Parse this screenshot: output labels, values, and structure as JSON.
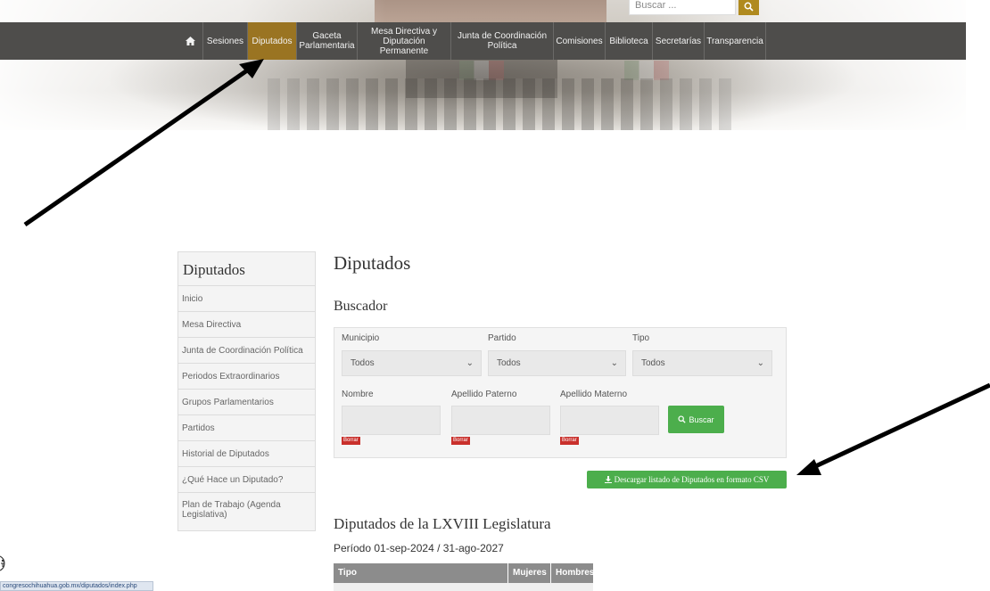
{
  "header": {
    "search_placeholder": "Buscar ...",
    "search_icon": "search-icon",
    "accent_color": "#9a7422"
  },
  "nav": {
    "home_icon": "home-icon",
    "items": [
      {
        "label": "Sesiones"
      },
      {
        "label": "Diputados",
        "active": true
      },
      {
        "label": "Gaceta Parlamentaria"
      },
      {
        "label": "Mesa Directiva y Diputación Permanente"
      },
      {
        "label": "Junta de Coordinación Política"
      },
      {
        "label": "Comisiones"
      },
      {
        "label": "Biblioteca"
      },
      {
        "label": "Secretarías"
      },
      {
        "label": "Transparencia"
      }
    ]
  },
  "sidebar": {
    "title": "Diputados",
    "items": [
      {
        "label": "Inicio"
      },
      {
        "label": "Mesa Directiva"
      },
      {
        "label": "Junta de Coordinación Política"
      },
      {
        "label": "Periodos Extraordinarios"
      },
      {
        "label": "Grupos Parlamentarios"
      },
      {
        "label": "Partidos"
      },
      {
        "label": "Historial de Diputados"
      },
      {
        "label": "¿Qué Hace un Diputado?"
      },
      {
        "label": "Plan de Trabajo (Agenda Legislativa)"
      }
    ]
  },
  "main": {
    "title": "Diputados",
    "search_title": "Buscador",
    "filters": {
      "municipio_label": "Municipio",
      "municipio_value": "Todos",
      "partido_label": "Partido",
      "partido_value": "Todos",
      "tipo_label": "Tipo",
      "tipo_value": "Todos",
      "nombre_label": "Nombre",
      "paterno_label": "Apellido Paterno",
      "materno_label": "Apellido Materno",
      "clear_label": "Borrar"
    },
    "buscar_button": "Buscar",
    "csv_button": "Descargar listado de Diputados en formato CSV",
    "legislature_title": "Diputados de la LXVIII Legislatura",
    "periodo": "Período 01-sep-2024 / 31-ago-2027",
    "table_headers": [
      "Tipo",
      "Mujeres",
      "Hombres"
    ]
  },
  "status_url": "congresochihuahua.gob.mx/diputados/index.php"
}
